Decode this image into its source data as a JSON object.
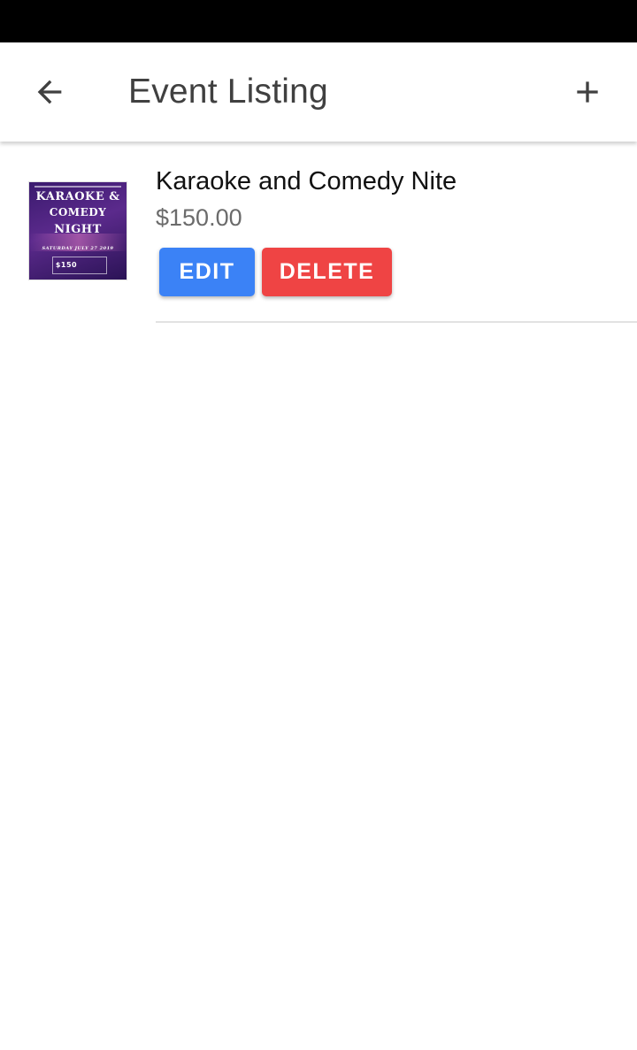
{
  "header": {
    "title": "Event Listing",
    "back_icon": "arrow-left-icon",
    "add_icon": "plus-icon"
  },
  "events": [
    {
      "title": "Karaoke and Comedy Nite",
      "price": "$150.00",
      "thumbnail": {
        "line1": "KARAOKE &",
        "line2": "COMEDY",
        "line3": "NIGHT",
        "date": "SATURDAY JULY 27 2019",
        "price": "$150"
      },
      "edit_label": "EDIT",
      "delete_label": "DELETE"
    }
  ],
  "colors": {
    "status_bar": "#000000",
    "title_text": "#404040",
    "edit_button": "#3b82f6",
    "delete_button": "#ef4444",
    "price_text": "#6b6b6b"
  }
}
